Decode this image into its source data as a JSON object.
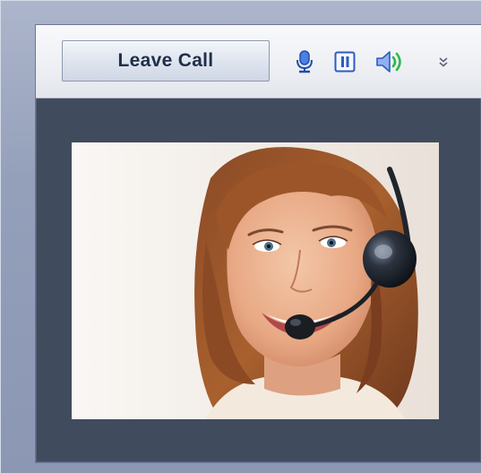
{
  "toolbar": {
    "leave_label": "Leave Call"
  },
  "icons": {
    "microphone": "microphone-icon",
    "pause": "pause-icon",
    "speaker": "speaker-volume-icon",
    "more": "chevron-double-down-icon"
  },
  "colors": {
    "frame": "#8b97b3",
    "panel_background": "#404b5d",
    "toolbar_background": "#eef0f4",
    "button_text": "#1f2e4a",
    "icon_blue": "#3b67c9",
    "speaker_green": "#2bb84a"
  }
}
